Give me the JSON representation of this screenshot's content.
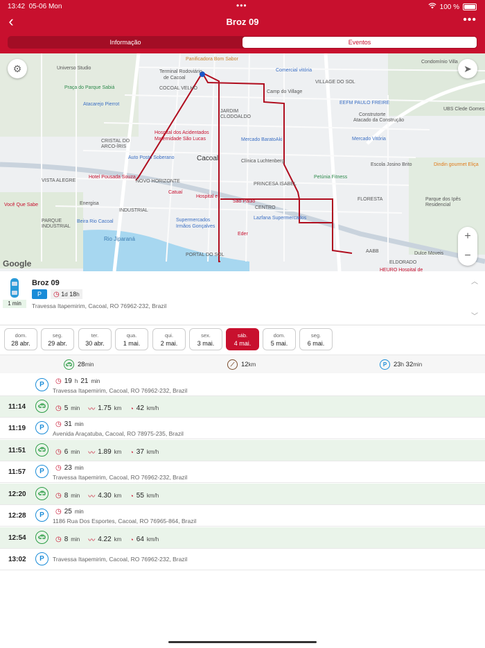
{
  "status_bar": {
    "time": "13:42",
    "date": "05-06 Mon",
    "battery": "100 %"
  },
  "header": {
    "title": "Broz 09",
    "back_icon": "chevron-left-icon",
    "more_icon": "ellipsis-icon"
  },
  "tabs": [
    {
      "label": "Informação",
      "active": false
    },
    {
      "label": "Eventos",
      "active": true
    }
  ],
  "map": {
    "attribution": "Google",
    "labels": [
      "Panificadora Bom Sabor",
      "Universo Studio",
      "Terminal Rodoviário de Cacoal",
      "R. Vinícius de Moraes",
      "Comercial vitória",
      "Condomínio Villa",
      "Praça do Parque Sabiá",
      "COCOAL VELHO",
      "Camp do Village",
      "VILLAGE DO SOL",
      "EEFM PAULO FREIRE",
      "Atacarejo Pierrot",
      "Hospital dos Acidentados",
      "Maternidade São Lucas",
      "JARDIM CLODOALDO",
      "Mercado BaratoAki",
      "Mercado Vitória",
      "Escola Josino Brito",
      "Cacoal",
      "Auto Posto Soberano",
      "Hotel Pousada Souza",
      "Clínica Luchtenberg",
      "PRINCESA ISABEL",
      "Petúnia Fitness",
      "Catuaí",
      "Hospital e",
      "São Paulo",
      "CENTRO",
      "Energisa",
      "Supermercados Irmãos Gonçalves",
      "Beira Rio Cacoal",
      "Lazfana Supermercados",
      "Eder",
      "AABB",
      "Rio Jiparaná",
      "Você Que Sabe",
      "Parque dos Ipês Residencial",
      "Dindin gourmet Eliça",
      "Construtorte",
      "Atacado da Construção",
      "Dulce Moveis",
      "HEURO Hospital de",
      "ELDORADO",
      "FLORESTA",
      "INDUSTRIAL",
      "CRISTAL DO ARCO-ÍRIS",
      "VISTA ALEGRE",
      "NOVO HORIZONTE",
      "PARQUE INDUSTRIAL",
      "PORTAL DO SOL",
      "UBS Clede Gomes"
    ],
    "gear_icon": "gear-icon",
    "locate_icon": "navigation-arrow-icon",
    "zoom_in": "+",
    "zoom_out": "−"
  },
  "vehicle": {
    "name": "Broz 09",
    "badge": "P",
    "duration_d": "1",
    "duration_h": "18",
    "unit_d": "d",
    "unit_h": "h",
    "address": "Travessa Itapemirim, Cacoal, RO 76962-232, Brazil",
    "car_min": "1 min",
    "car_icon": "car-icon"
  },
  "days": [
    {
      "dow": "dom.",
      "date": "28 abr.",
      "active": false
    },
    {
      "dow": "seg.",
      "date": "29 abr.",
      "active": false
    },
    {
      "dow": "ter.",
      "date": "30 abr.",
      "active": false
    },
    {
      "dow": "qua.",
      "date": "1 mai.",
      "active": false
    },
    {
      "dow": "qui.",
      "date": "2 mai.",
      "active": false
    },
    {
      "dow": "sex.",
      "date": "3 mai.",
      "active": false
    },
    {
      "dow": "sáb.",
      "date": "4 mai.",
      "active": true
    },
    {
      "dow": "dom.",
      "date": "5 mai.",
      "active": false
    },
    {
      "dow": "seg.",
      "date": "6 mai.",
      "active": false
    }
  ],
  "summary": {
    "drive": "28",
    "drive_unit": "min",
    "distance": "12",
    "distance_unit": "km",
    "park_h": "23",
    "park_h_unit": "h",
    "park_m": "32",
    "park_m_unit": "min"
  },
  "events": [
    {
      "type": "park",
      "time": "",
      "duration": "19",
      "duration_unit": "h",
      "duration2": "21",
      "duration2_unit": "min",
      "address": "Travessa Itapemirim, Cacoal, RO 76962-232, Brazil"
    },
    {
      "type": "drive",
      "time": "11:14",
      "duration": "5",
      "duration_unit": "min",
      "distance": "1.75",
      "distance_unit": "km",
      "speed": "42",
      "speed_unit": "km/h"
    },
    {
      "type": "park",
      "time": "11:19",
      "duration": "31",
      "duration_unit": "min",
      "address": "Avenida Araçatuba, Cacoal, RO 78975-235, Brazil"
    },
    {
      "type": "drive",
      "time": "11:51",
      "duration": "6",
      "duration_unit": "min",
      "distance": "1.89",
      "distance_unit": "km",
      "speed": "37",
      "speed_unit": "km/h"
    },
    {
      "type": "park",
      "time": "11:57",
      "duration": "23",
      "duration_unit": "min",
      "address": "Travessa Itapemirim, Cacoal, RO 76962-232, Brazil"
    },
    {
      "type": "drive",
      "time": "12:20",
      "duration": "8",
      "duration_unit": "min",
      "distance": "4.30",
      "distance_unit": "km",
      "speed": "55",
      "speed_unit": "km/h"
    },
    {
      "type": "park",
      "time": "12:28",
      "duration": "25",
      "duration_unit": "min",
      "address": "1186 Rua Dos Esportes, Cacoal, RO 76965-864, Brazil"
    },
    {
      "type": "drive",
      "time": "12:54",
      "duration": "8",
      "duration_unit": "min",
      "distance": "4.22",
      "distance_unit": "km",
      "speed": "64",
      "speed_unit": "km/h"
    },
    {
      "type": "park",
      "time": "13:02",
      "address": "Travessa Itapemirim, Cacoal, RO 76962-232, Brazil"
    }
  ],
  "colors": {
    "brand": "#c8102e",
    "park": "#1a8cd8",
    "drive": "#2e9e47",
    "distance": "#7a4b2a",
    "route": "#b00e1f"
  },
  "icons": {
    "park": "parking-icon",
    "drive": "car-icon",
    "clock": "clock-icon",
    "distance": "trend-line-icon",
    "speed": "speedometer-icon"
  }
}
